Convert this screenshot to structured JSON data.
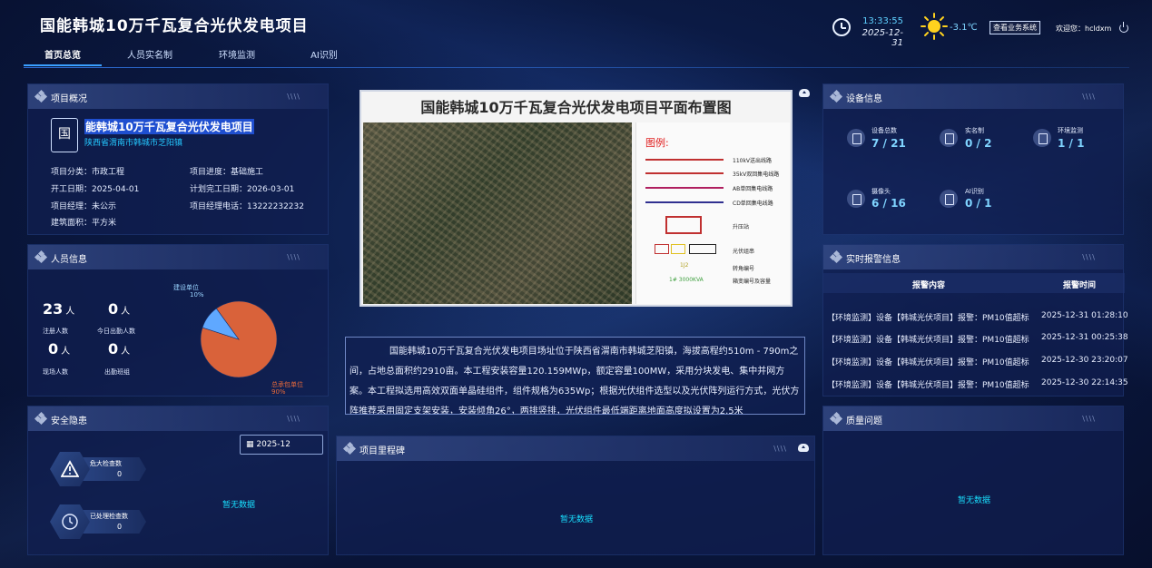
{
  "header": {
    "title": "国能韩城10万千瓦复合光伏发电项目",
    "time": "13:33:55",
    "date": "2025-12-31",
    "temperature": "-3.1℃",
    "biz_button": "查看业务系统",
    "welcome": "欢迎您：hcldxm"
  },
  "nav": {
    "tabs": [
      "首页总览",
      "人员实名制",
      "环境监测",
      "AI识别"
    ]
  },
  "project_overview": {
    "panel_title": "项目概况",
    "logo_text": "国",
    "name": "能韩城10万千瓦复合光伏发电项目",
    "location": "陕西省渭南市韩城市芝阳镇",
    "fields": [
      "项目分类：市政工程",
      "项目进度：基础施工",
      "开工日期：2025-04-01",
      "计划完工日期：2026-03-01",
      "项目经理：未公示",
      "项目经理电话：13222232232",
      "建筑面积：平方米"
    ]
  },
  "personnel": {
    "panel_title": "人员信息",
    "stats": [
      {
        "value": "23",
        "unit": "人",
        "label": "注册人数"
      },
      {
        "value": "0",
        "unit": "人",
        "label": "今日出勤人数"
      },
      {
        "value": "0",
        "unit": "人",
        "label": "现场人数"
      },
      {
        "value": "0",
        "unit": "人",
        "label": "出勤班组"
      }
    ]
  },
  "chart_data": {
    "type": "pie",
    "slices": [
      {
        "name": "总承包单位",
        "label": "90%",
        "value": 90,
        "color": "#d9623a"
      },
      {
        "name": "建设单位",
        "label": "10%",
        "value": 10,
        "color": "#5fa8ff"
      }
    ]
  },
  "safety": {
    "panel_title": "安全隐患",
    "date_value": "2025-12",
    "badges": [
      {
        "label": "危大检查数",
        "value": "0"
      },
      {
        "label": "已处理检查数",
        "value": "0"
      }
    ],
    "no_data": "暂无数据"
  },
  "map": {
    "title": "国能韩城10万千瓦复合光伏发电项目平面布置图",
    "legend_title": "图例:",
    "legend_lines": [
      {
        "text": "110kV送出线路",
        "color": "#c03030"
      },
      {
        "text": "35kV双回集电线路",
        "color": "#c03030"
      },
      {
        "text": "AB单回集电线路",
        "color": "#b02060"
      },
      {
        "text": "CD单回集电线路",
        "color": "#303090"
      }
    ],
    "legend_station": "升压站",
    "legend_module": "光伏组串",
    "legend_code": "1J2",
    "legend_code_text": "转角编号",
    "legend_box": "1# 3000KVA",
    "legend_box_text": "箱变编号及容量"
  },
  "description": {
    "text": "国能韩城10万千瓦复合光伏发电项目场址位于陕西省渭南市韩城芝阳镇，海拔高程约510m - 790m之间，占地总面积约2910亩。本工程安装容量120.159MWp，额定容量100MW，采用分块发电、集中并网方案。本工程拟选用高效双面单晶硅组件，组件规格为635Wp；根据光伏组件选型以及光伏阵列运行方式，光伏方阵推荐采用固定支架安装，安装倾角26°，两排竖排，光伏组件最低端距离地面高度拟设置为2.5米"
  },
  "milestone": {
    "panel_title": "项目里程碑",
    "no_data": "暂无数据"
  },
  "equipment": {
    "panel_title": "设备信息",
    "items": [
      {
        "label": "设备总数",
        "value": "7 / 21"
      },
      {
        "label": "实名制",
        "value": "0 / 2"
      },
      {
        "label": "环境监测",
        "value": "1 / 1"
      },
      {
        "label": "摄像头",
        "value": "6 / 16"
      },
      {
        "label": "AI识别",
        "value": "0 / 1"
      }
    ]
  },
  "alarms": {
    "panel_title": "实时报警信息",
    "col_content": "报警内容",
    "col_time": "报警时间",
    "rows": [
      {
        "content": "【环境监测】设备【韩城光伏项目】报警：PM10值超标",
        "time": "2025-12-31 01:28:10"
      },
      {
        "content": "【环境监测】设备【韩城光伏项目】报警：PM10值超标",
        "time": "2025-12-31 00:25:38"
      },
      {
        "content": "【环境监测】设备【韩城光伏项目】报警：PM10值超标",
        "time": "2025-12-30 23:20:07"
      },
      {
        "content": "【环境监测】设备【韩城光伏项目】报警：PM10值超标",
        "time": "2025-12-30 22:14:35"
      }
    ]
  },
  "quality": {
    "panel_title": "质量问题",
    "no_data": "暂无数据"
  }
}
